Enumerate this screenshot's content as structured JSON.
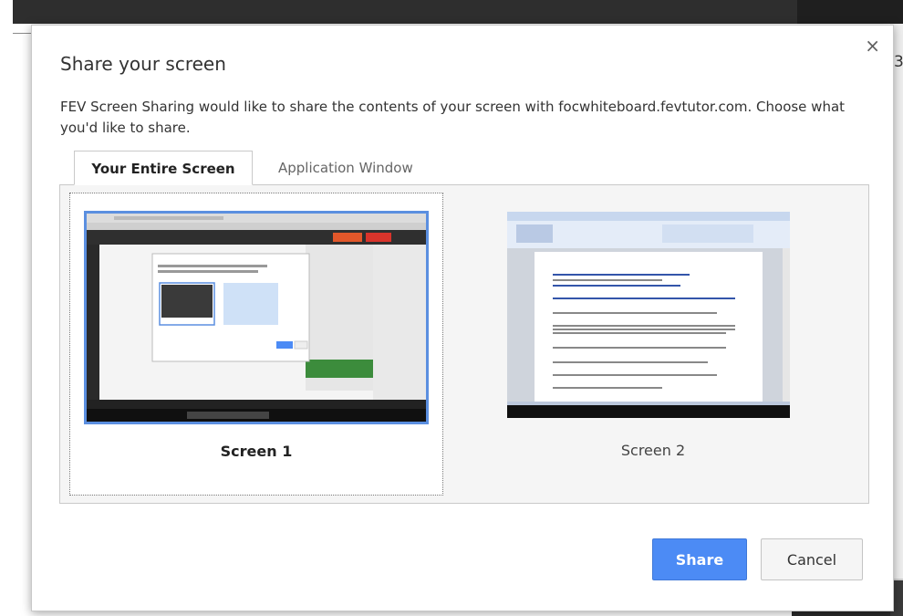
{
  "dialog": {
    "title": "Share your screen",
    "description": "FEV Screen Sharing would like to share the contents of your screen with focwhiteboard.fevtutor.com. Choose what you'd like to share.",
    "close_glyph": "×"
  },
  "tabs": [
    {
      "label": "Your Entire Screen",
      "active": true
    },
    {
      "label": "Application Window",
      "active": false
    }
  ],
  "screens": [
    {
      "label": "Screen 1",
      "selected": true
    },
    {
      "label": "Screen 2",
      "selected": false
    }
  ],
  "buttons": {
    "share": "Share",
    "cancel": "Cancel"
  },
  "background": {
    "right_edge_char": "3"
  },
  "colors": {
    "accent": "#4c8bf5",
    "selection_border": "#5b8fe0"
  }
}
